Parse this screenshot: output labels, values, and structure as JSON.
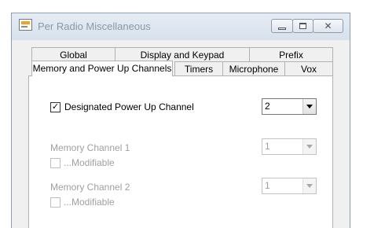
{
  "window": {
    "title": "Per Radio Miscellaneous",
    "app_icon": "radio-icon",
    "caption_buttons": {
      "minimize_icon": "minimize-icon",
      "maximize_icon": "maximize-icon",
      "close_glyph": "✕"
    }
  },
  "tabs": {
    "row1": [
      {
        "label": "Global"
      },
      {
        "label": "Display and Keypad"
      },
      {
        "label": "Prefix"
      }
    ],
    "row2": [
      {
        "label": "Memory and Power Up Channels",
        "selected": true
      },
      {
        "label": "Timers"
      },
      {
        "label": "Microphone"
      },
      {
        "label": "Vox"
      }
    ]
  },
  "panel": {
    "designated": {
      "label": "Designated Power Up Channel",
      "checked": true,
      "check_glyph": "✓",
      "value": "2"
    },
    "mem1": {
      "label": "Memory Channel 1",
      "value": "1",
      "modifiable_label": "...Modifiable",
      "enabled": false
    },
    "mem2": {
      "label": "Memory Channel 2",
      "value": "1",
      "modifiable_label": "...Modifiable",
      "enabled": false
    }
  }
}
